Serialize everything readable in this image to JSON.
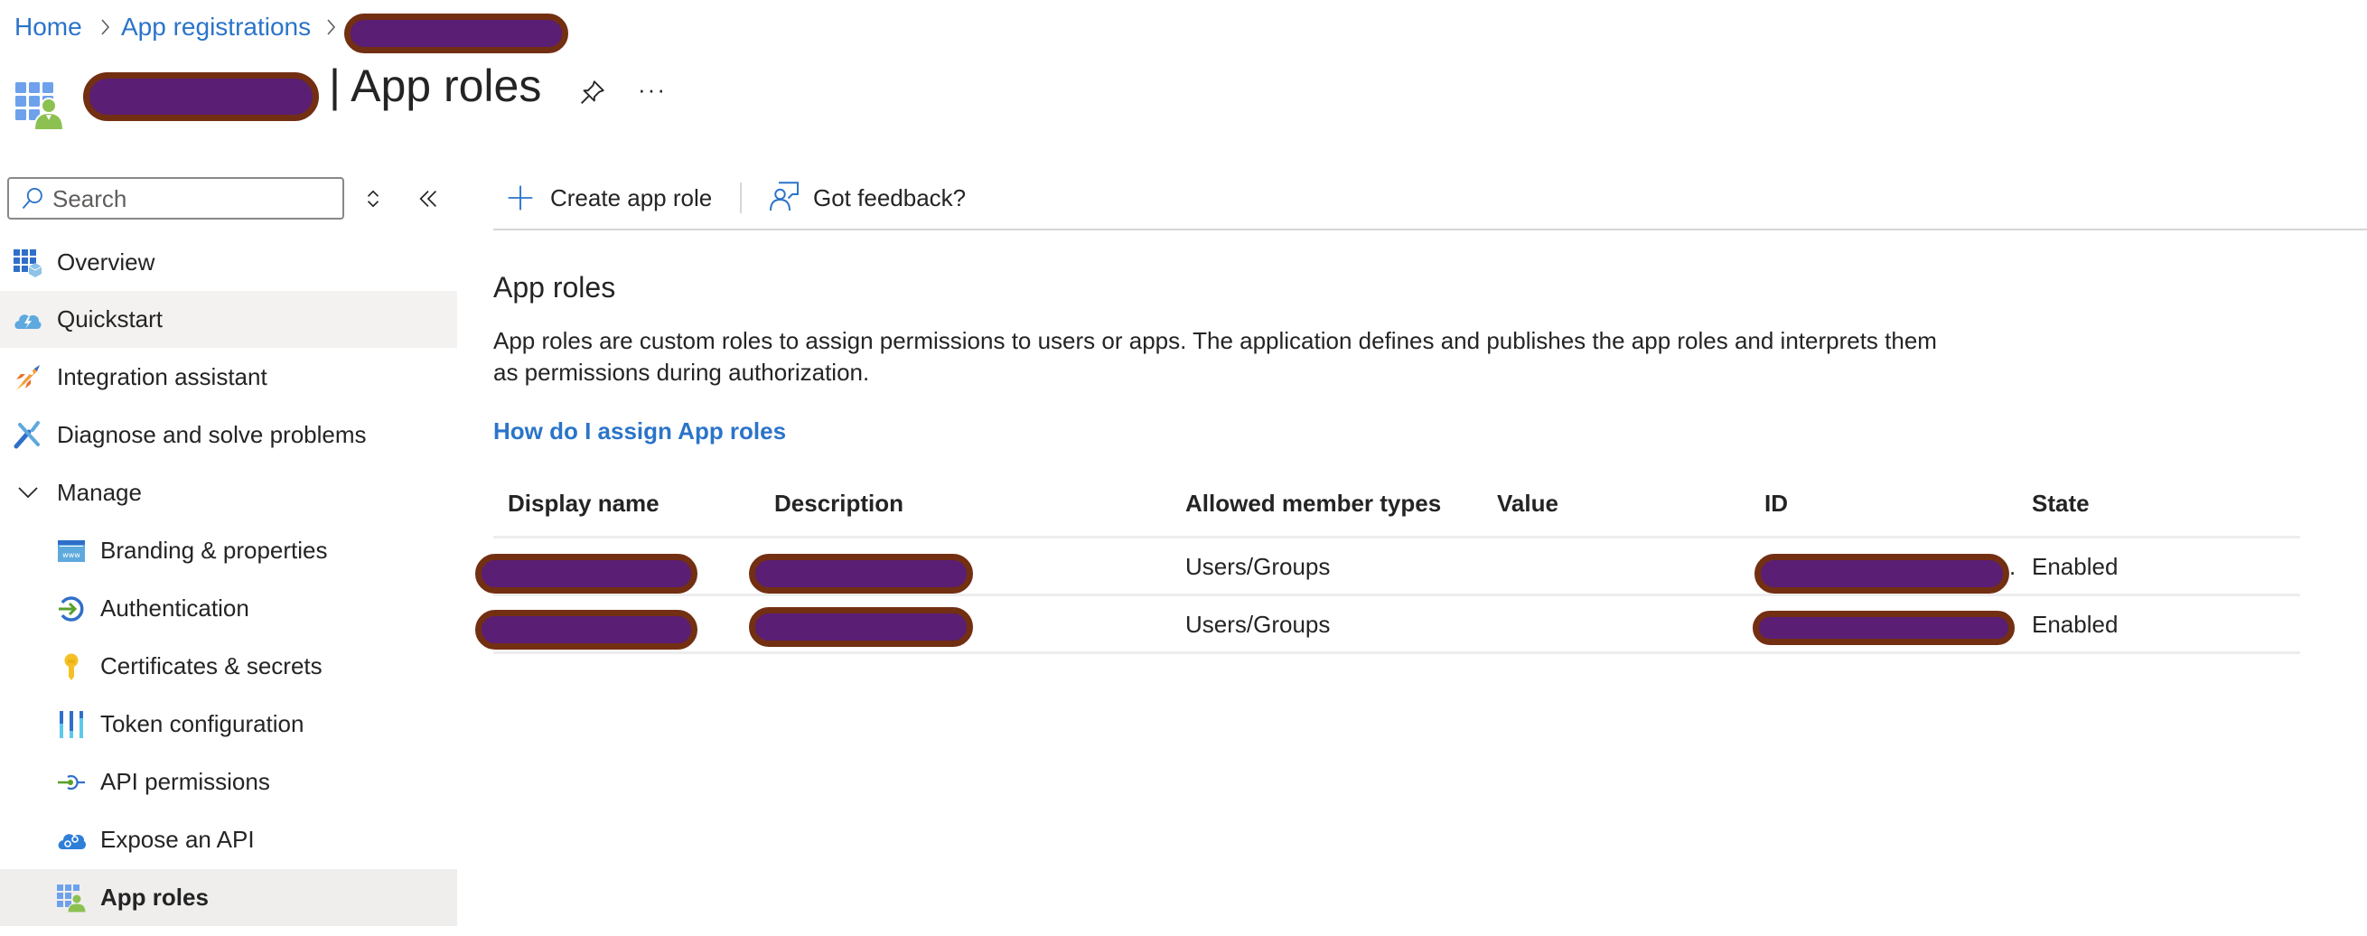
{
  "breadcrumb": {
    "items": [
      {
        "label": "Home"
      },
      {
        "label": "App registrations"
      },
      {
        "label": "[redacted]"
      }
    ]
  },
  "header": {
    "app_name": "[redacted]",
    "title": "| App roles",
    "pin_icon": "pin-icon",
    "more_icon": "ellipsis-icon",
    "more_glyph": "···"
  },
  "sidebar": {
    "search_placeholder": "Search",
    "items": [
      {
        "label": "Overview",
        "icon": "overview-icon"
      },
      {
        "label": "Quickstart",
        "icon": "quickstart-cloud-icon"
      },
      {
        "label": "Integration assistant",
        "icon": "rocket-icon"
      },
      {
        "label": "Diagnose and solve problems",
        "icon": "wrench-icon"
      },
      {
        "label": "Manage",
        "icon": "chevron-down-icon"
      },
      {
        "label": "Branding & properties",
        "icon": "www-icon"
      },
      {
        "label": "Authentication",
        "icon": "sign-in-icon"
      },
      {
        "label": "Certificates & secrets",
        "icon": "key-icon"
      },
      {
        "label": "Token configuration",
        "icon": "token-bars-icon"
      },
      {
        "label": "API permissions",
        "icon": "api-permissions-icon"
      },
      {
        "label": "Expose an API",
        "icon": "cloud-gears-icon"
      },
      {
        "label": "App roles",
        "icon": "app-roles-icon"
      }
    ],
    "selected": "App roles",
    "hovered": "Quickstart"
  },
  "toolbar": {
    "create_label": "Create app role",
    "feedback_label": "Got feedback?"
  },
  "main": {
    "heading": "App roles",
    "description_line1": "App roles are custom roles to assign permissions to users or apps. The application defines and publishes the app roles and interprets them",
    "description_line2": "as permissions during authorization.",
    "help_link": "How do I assign App roles",
    "table": {
      "columns": [
        "Display name",
        "Description",
        "Allowed member types",
        "Value",
        "ID",
        "State"
      ],
      "rows": [
        {
          "display_name": "[redacted]",
          "description": "[redacted]",
          "allowed_member_types": "Users/Groups",
          "value": "",
          "id": "[redacted]",
          "id_ellipsis": ".",
          "state": "Enabled"
        },
        {
          "display_name": "[redacted]",
          "description": "[redacted]",
          "allowed_member_types": "Users/Groups",
          "value": "",
          "id": "[redacted]",
          "id_ellipsis": "",
          "state": "Enabled"
        }
      ]
    }
  },
  "colors": {
    "link": "#2B74C9",
    "selected_bg": "#EFEEED",
    "redaction_fill": "#5A1E75",
    "redaction_border": "#722F12"
  }
}
